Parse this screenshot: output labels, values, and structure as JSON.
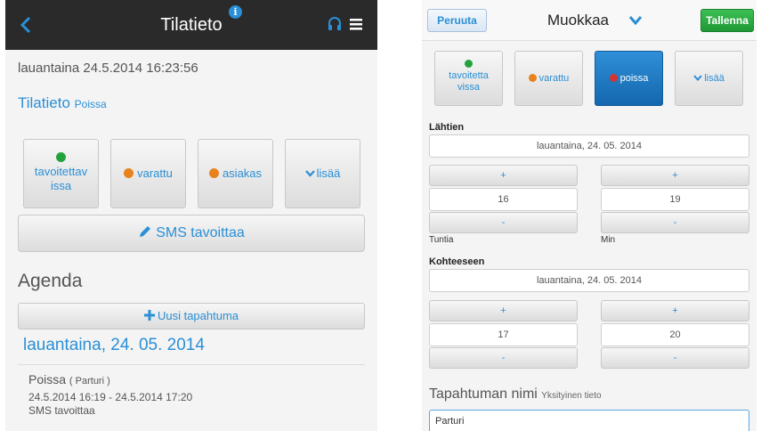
{
  "left": {
    "header": {
      "title": "Tilatieto"
    },
    "datetime": "lauantaina 24.5.2014 16:23:56",
    "status": {
      "label": "Tilatieto",
      "value": "Poissa"
    },
    "status_buttons": [
      {
        "line1": "tavoitettav",
        "line2": "issa",
        "icon": "green-dot"
      },
      {
        "label": "varattu",
        "icon": "orange-dot"
      },
      {
        "label": "asiakas",
        "icon": "orange-dot"
      },
      {
        "label": "lisää",
        "icon": "chevron-down"
      }
    ],
    "sms_button": "SMS tavoittaa",
    "agenda_title": "Agenda",
    "new_event_button": "Uusi tapahtuma",
    "date_heading": "lauantaina, 24. 05. 2014",
    "event": {
      "title": "Poissa",
      "subtitle": "( Parturi )",
      "time": "24.5.2014 16:19 - 24.5.2014 17:20",
      "note": "SMS tavoittaa"
    }
  },
  "right": {
    "header": {
      "cancel": "Peruuta",
      "title": "Muokkaa",
      "save": "Tallenna"
    },
    "status_buttons": [
      {
        "line1": "tavoitetta",
        "line2": "vissa",
        "icon": "green-dot"
      },
      {
        "label": "varattu",
        "icon": "orange-dot"
      },
      {
        "label": "poissa",
        "icon": "red-dot",
        "active": true
      },
      {
        "label": "lisää",
        "icon": "chevron-down"
      }
    ],
    "start": {
      "label": "Lähtien",
      "date": "lauantaina, 24. 05. 2014",
      "hours": "16",
      "minutes": "19",
      "hours_unit": "Tuntia",
      "minutes_unit": "Min"
    },
    "end": {
      "label": "Kohteeseen",
      "date": "lauantaina, 24. 05. 2014",
      "hours": "17",
      "minutes": "20"
    },
    "stepper": {
      "plus": "+",
      "minus": "-"
    },
    "event_name": {
      "label": "Tapahtuman nimi",
      "hint": "Yksityinen tieto",
      "value": "Parturi"
    }
  },
  "colors": {
    "accent": "#2a8fd6",
    "header_dark": "#2a2a2a",
    "save_green": "#1f9835",
    "active_blue": "#1467ad"
  }
}
